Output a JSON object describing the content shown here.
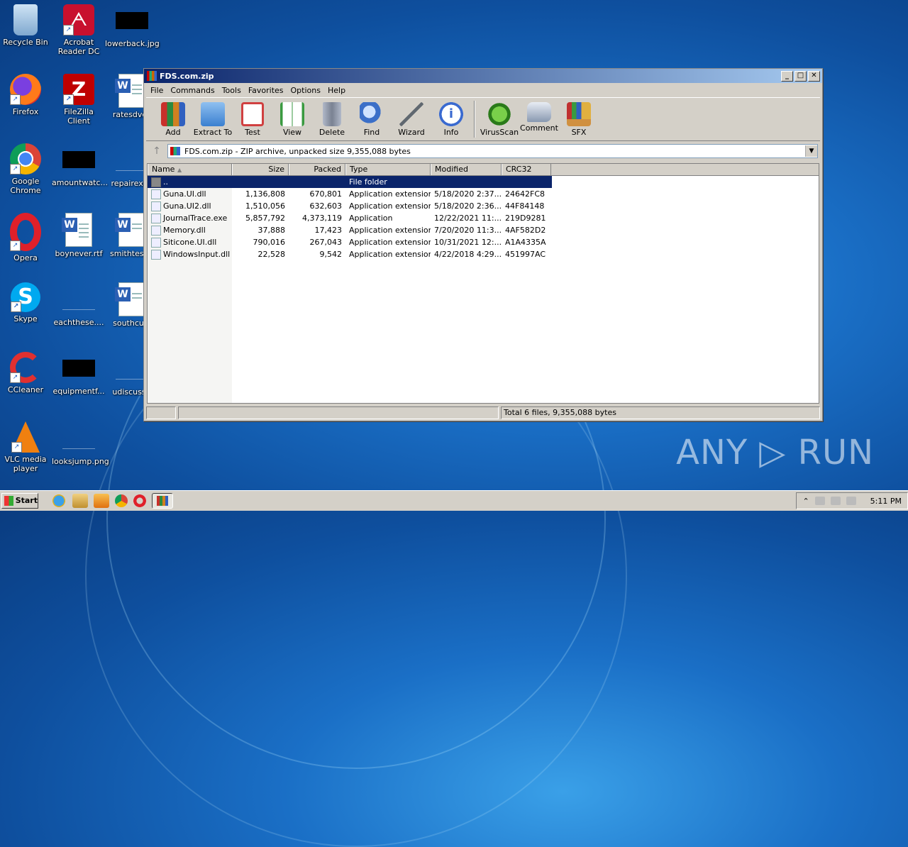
{
  "desktop": {
    "icons": [
      {
        "label": "Recycle Bin"
      },
      {
        "label": "Acrobat Reader DC"
      },
      {
        "label": "lowerback.jpg"
      },
      {
        "label": "Firefox"
      },
      {
        "label": "FileZilla Client"
      },
      {
        "label": "ratesdvds"
      },
      {
        "label": "Google Chrome"
      },
      {
        "label": "amountwatc..."
      },
      {
        "label": "repairexpe"
      },
      {
        "label": "Opera"
      },
      {
        "label": "boynever.rtf"
      },
      {
        "label": "smithtestin"
      },
      {
        "label": "Skype"
      },
      {
        "label": "eachthese...."
      },
      {
        "label": "southcust"
      },
      {
        "label": "CCleaner"
      },
      {
        "label": "equipmentf..."
      },
      {
        "label": "udiscuss.r"
      },
      {
        "label": "VLC media player"
      },
      {
        "label": "looksjump.png"
      }
    ]
  },
  "window": {
    "title": "FDS.com.zip",
    "controls": {
      "minimize": "_",
      "maximize": "□",
      "close": "✕"
    },
    "menu": [
      "File",
      "Commands",
      "Tools",
      "Favorites",
      "Options",
      "Help"
    ],
    "toolbar": [
      {
        "label": "Add",
        "color": "#c8302a"
      },
      {
        "label": "Extract To",
        "color": "#3a7fd0"
      },
      {
        "label": "Test",
        "color": "#d04040"
      },
      {
        "label": "View",
        "color": "#3a9a40"
      },
      {
        "label": "Delete",
        "color": "#9098a8"
      },
      {
        "label": "Find",
        "color": "#3b6fc8"
      },
      {
        "label": "Wizard",
        "color": "#b0b8c0"
      },
      {
        "label": "Info",
        "color": "#3a6ad0"
      },
      {
        "label": "VirusScan",
        "color": "#3aa02a"
      },
      {
        "label": "Comment",
        "color": "#8898b0"
      },
      {
        "label": "SFX",
        "color": "#d09040"
      }
    ],
    "address": "FDS.com.zip - ZIP archive, unpacked size 9,355,088 bytes",
    "columns": [
      "Name",
      "Size",
      "Packed",
      "Type",
      "Modified",
      "CRC32"
    ],
    "sort_indicator": "▲",
    "rows": [
      {
        "name": "..",
        "size": "",
        "packed": "",
        "type": "File folder",
        "modified": "",
        "crc": "",
        "selected": true
      },
      {
        "name": "Guna.UI.dll",
        "size": "1,136,808",
        "packed": "670,801",
        "type": "Application extension",
        "modified": "5/18/2020 2:37...",
        "crc": "24642FC8"
      },
      {
        "name": "Guna.UI2.dll",
        "size": "1,510,056",
        "packed": "632,603",
        "type": "Application extension",
        "modified": "5/18/2020 2:36...",
        "crc": "44F84148"
      },
      {
        "name": "JournalTrace.exe",
        "size": "5,857,792",
        "packed": "4,373,119",
        "type": "Application",
        "modified": "12/22/2021 11:...",
        "crc": "219D9281"
      },
      {
        "name": "Memory.dll",
        "size": "37,888",
        "packed": "17,423",
        "type": "Application extension",
        "modified": "7/20/2020 11:3...",
        "crc": "4AF582D2"
      },
      {
        "name": "Siticone.UI.dll",
        "size": "790,016",
        "packed": "267,043",
        "type": "Application extension",
        "modified": "10/31/2021 12:...",
        "crc": "A1A4335A"
      },
      {
        "name": "WindowsInput.dll",
        "size": "22,528",
        "packed": "9,542",
        "type": "Application extension",
        "modified": "4/22/2018 4:29...",
        "crc": "451997AC"
      }
    ],
    "status": "Total 6 files, 9,355,088 bytes"
  },
  "taskbar": {
    "start_label": "Start",
    "clock": "5:11 PM"
  },
  "watermark": "ANY ▷ RUN"
}
